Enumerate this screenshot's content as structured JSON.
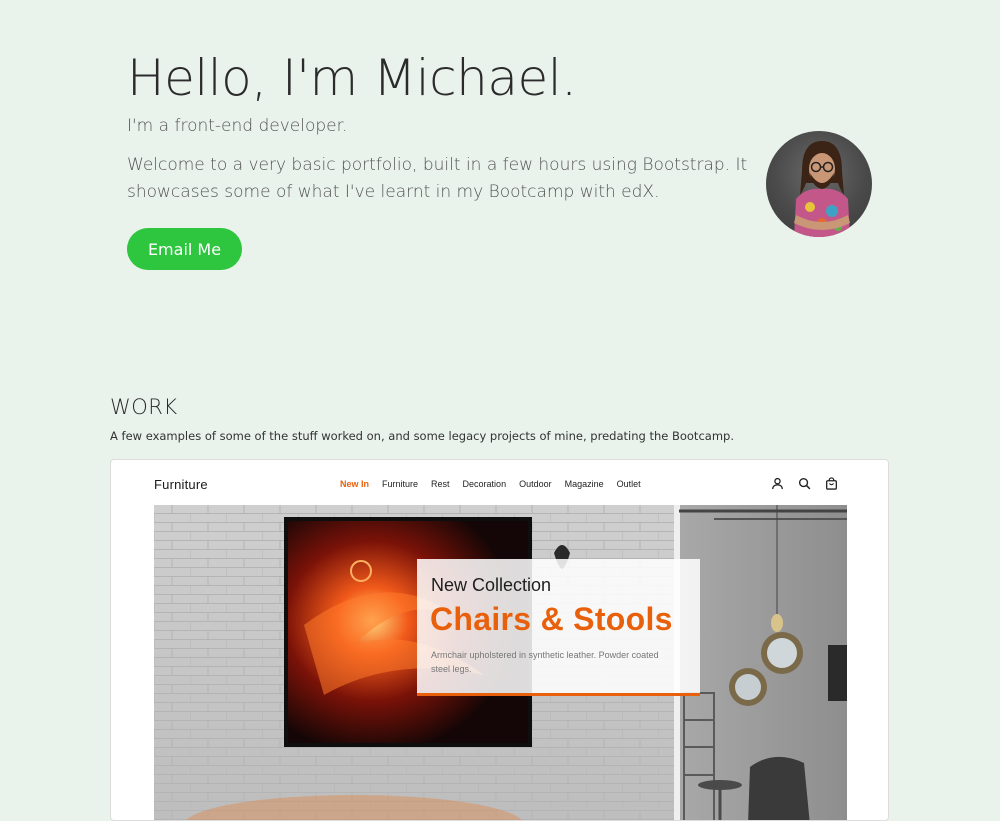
{
  "hero": {
    "title": "Hello, I'm Michael.",
    "subtitle": "I'm a front-end developer.",
    "intro": "Welcome to a very basic portfolio, built in a few hours using Bootstrap. It showcases some of what I've learnt in my Bootcamp with edX.",
    "email_button": "Email Me"
  },
  "work": {
    "title": "WORK",
    "description": "A few examples of some of the stuff worked on, and some legacy projects of mine, predating the Bootcamp."
  },
  "project": {
    "brand": "Furniture",
    "nav": [
      "New In",
      "Furniture",
      "Rest",
      "Decoration",
      "Outdoor",
      "Magazine",
      "Outlet"
    ],
    "active_nav": "New In",
    "icons": [
      "user-icon",
      "search-icon",
      "cart-icon"
    ],
    "overlay": {
      "subtitle": "New Collection",
      "title": "Chairs & Stools",
      "description": "Armchair upholstered in synthetic leather. Powder coated steel legs."
    }
  },
  "colors": {
    "background": "#eaf2ec",
    "button_green": "#2ec53f",
    "accent_orange": "#e8600c"
  }
}
